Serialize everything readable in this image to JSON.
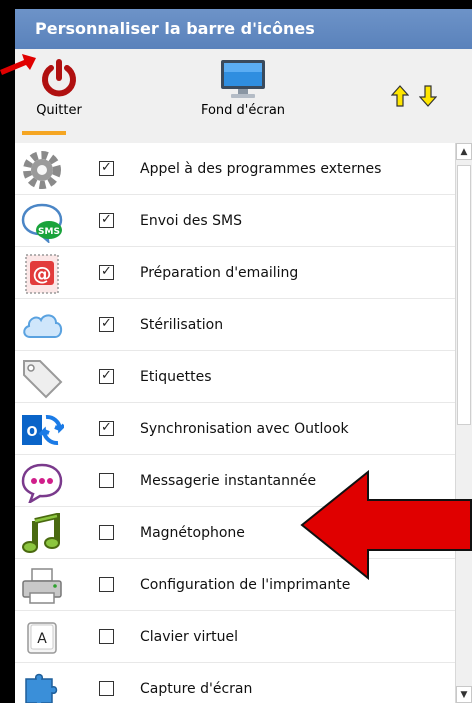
{
  "window": {
    "title": "Personnaliser la barre d'icônes"
  },
  "toolbar": {
    "quit_label": "Quitter",
    "wallpaper_label": "Fond d'écran",
    "move_up_icon": "arrow-up-icon",
    "move_down_icon": "arrow-down-icon"
  },
  "items": [
    {
      "label": "Appel à des programmes externes",
      "checked": true,
      "icon": "gear-icon"
    },
    {
      "label": "Envoi des SMS",
      "checked": true,
      "icon": "sms-bubble-icon"
    },
    {
      "label": "Préparation d'emailing",
      "checked": true,
      "icon": "email-at-icon"
    },
    {
      "label": "Stérilisation",
      "checked": true,
      "icon": "cloud-icon"
    },
    {
      "label": "Etiquettes",
      "checked": true,
      "icon": "tag-icon"
    },
    {
      "label": "Synchronisation avec Outlook",
      "checked": true,
      "icon": "outlook-sync-icon"
    },
    {
      "label": "Messagerie instantannée",
      "checked": false,
      "icon": "chat-bubble-icon"
    },
    {
      "label": "Magnétophone",
      "checked": false,
      "icon": "music-note-icon"
    },
    {
      "label": "Configuration de l'imprimante",
      "checked": false,
      "icon": "printer-icon"
    },
    {
      "label": "Clavier virtuel",
      "checked": false,
      "icon": "keyboard-key-icon"
    },
    {
      "label": "Capture d'écran",
      "checked": false,
      "icon": "puzzle-icon"
    }
  ],
  "colors": {
    "titlebar": "#5f88c1",
    "annotation_red": "#e00000",
    "accent_orange": "#f5a623"
  }
}
